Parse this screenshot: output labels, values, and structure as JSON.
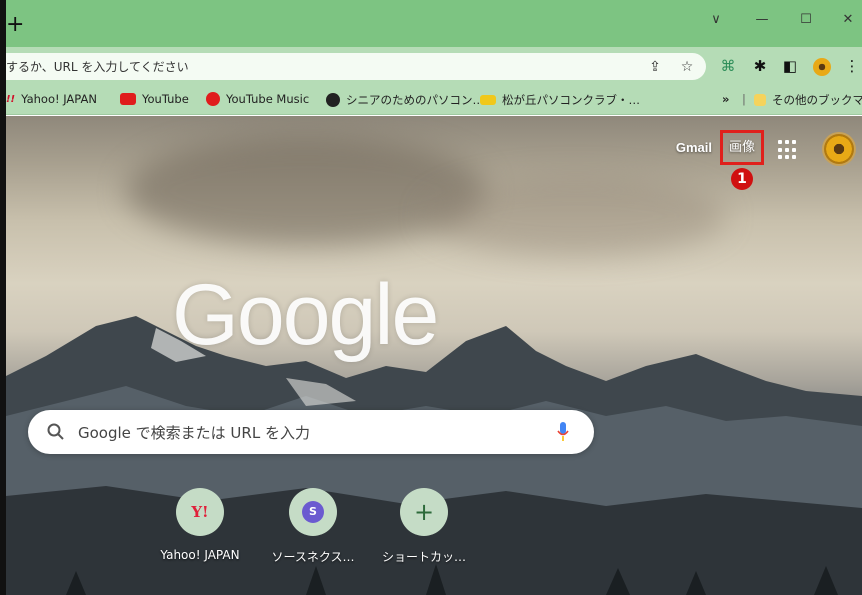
{
  "colors": {
    "title_bar": "#7dc482",
    "toolbar": "#b5dcb6",
    "highlight": "#e0201c",
    "marker": "#d01010"
  },
  "titlebar": {
    "new_tab": "+",
    "dropdown": "∨",
    "minimize": "—",
    "maximize": "☐",
    "close": "✕"
  },
  "omnibox": {
    "text": "するか、URL を入力してください"
  },
  "toolbar_icons": [
    "share-icon",
    "star-icon",
    "extension-icon",
    "puzzle-icon",
    "side-panel-icon",
    "profile-icon",
    "menu-icon"
  ],
  "bookmarks": {
    "items": [
      {
        "label": "Yahoo! JAPAN",
        "icon": "yahoo-icon"
      },
      {
        "label": "YouTube",
        "icon": "youtube-icon"
      },
      {
        "label": "YouTube Music",
        "icon": "youtube-music-icon"
      },
      {
        "label": "シニアのためのパソコン…",
        "icon": "globe-icon"
      },
      {
        "label": "松が丘パソコンクラブ・…",
        "icon": "club-icon"
      }
    ],
    "overflow": "»",
    "other": "その他のブックマーク"
  },
  "header": {
    "gmail": "Gmail",
    "images": "画像",
    "marker": "1"
  },
  "logo": "Google",
  "search": {
    "placeholder": "Google で検索または URL を入力"
  },
  "shortcuts": [
    {
      "label": "Yahoo! JAPAN",
      "icon": "Y!"
    },
    {
      "label": "ソースネクス…",
      "icon": "S"
    },
    {
      "label": "ショートカッ…",
      "icon": "+"
    }
  ]
}
